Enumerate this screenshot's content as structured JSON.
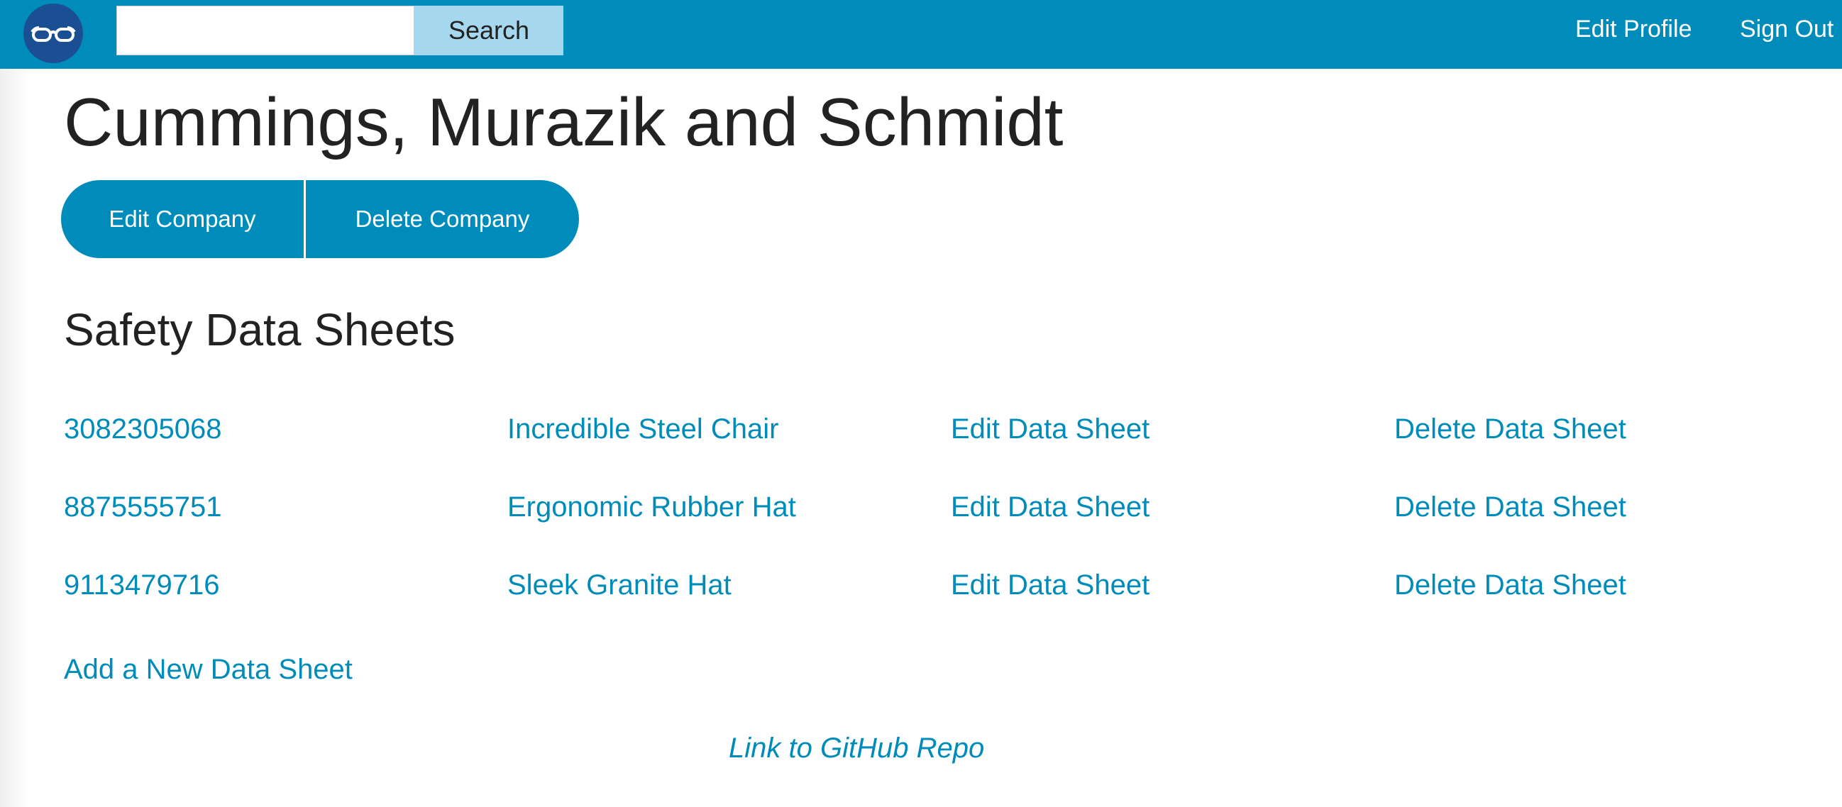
{
  "header": {
    "logo_icon": "glasses-icon",
    "search": {
      "value": "",
      "placeholder": "",
      "button_label": "Search"
    },
    "nav": {
      "edit_profile": "Edit Profile",
      "sign_out": "Sign Out"
    }
  },
  "company": {
    "name": "Cummings, Murazik and Schmidt",
    "edit_label": "Edit Company",
    "delete_label": "Delete Company"
  },
  "data_sheets": {
    "heading": "Safety Data Sheets",
    "rows": [
      {
        "id": "3082305068",
        "product": "Incredible Steel Chair",
        "edit": "Edit Data Sheet",
        "delete": "Delete Data Sheet"
      },
      {
        "id": "8875555751",
        "product": "Ergonomic Rubber Hat",
        "edit": "Edit Data Sheet",
        "delete": "Delete Data Sheet"
      },
      {
        "id": "9113479716",
        "product": "Sleek Granite Hat",
        "edit": "Edit Data Sheet",
        "delete": "Delete Data Sheet"
      }
    ],
    "add_label": "Add a New Data Sheet"
  },
  "footer": {
    "repo_link": "Link to GitHub Repo"
  },
  "colors": {
    "primary": "#008cba",
    "logo_bg": "#1b4f94",
    "search_button": "#a5d8ee",
    "text": "#222222"
  }
}
